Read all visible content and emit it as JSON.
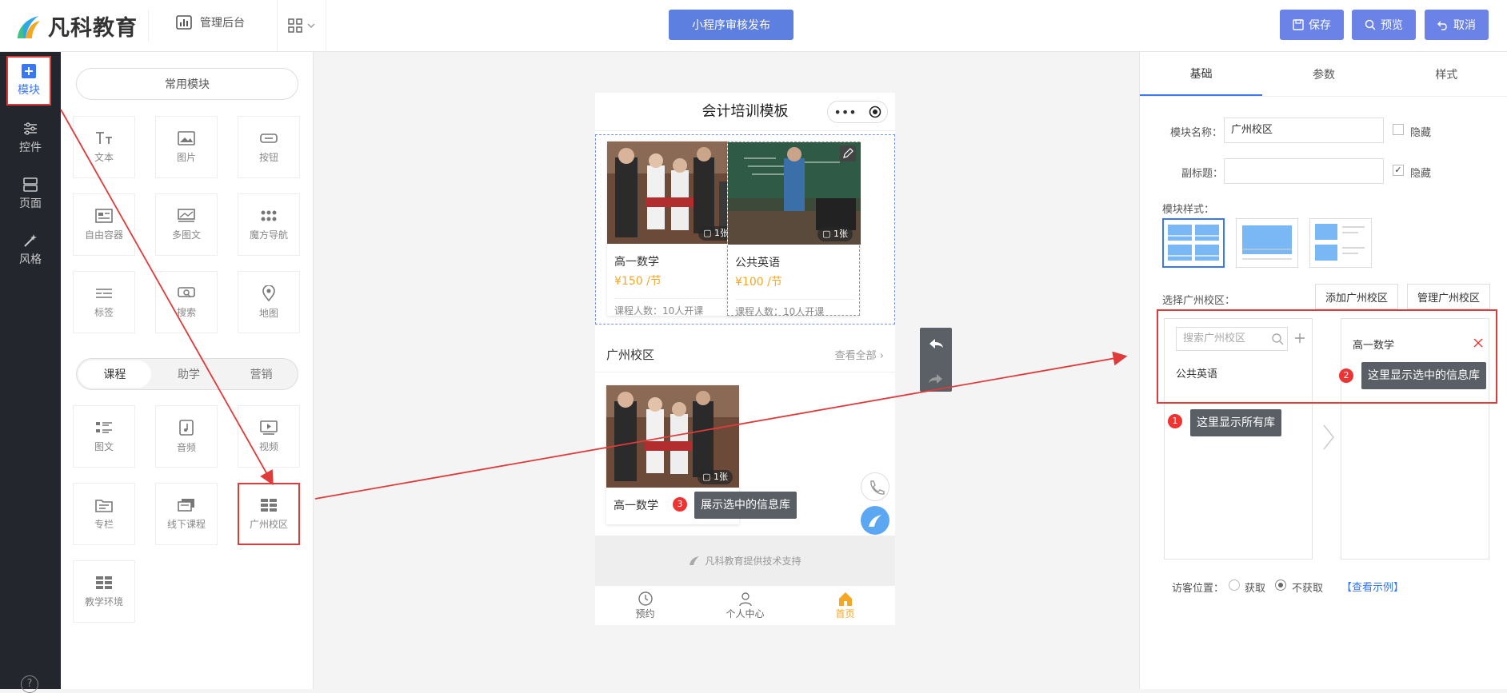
{
  "header": {
    "logo_text": "凡科教育",
    "admin_label": "管理后台",
    "publish_label": "小程序审核发布",
    "save_label": "保存",
    "preview_label": "预览",
    "cancel_label": "取消"
  },
  "rail": {
    "items": [
      {
        "label": "模块",
        "icon": "plus-square-icon"
      },
      {
        "label": "控件",
        "icon": "sliders-icon"
      },
      {
        "label": "页面",
        "icon": "pages-icon"
      },
      {
        "label": "风格",
        "icon": "magic-wand-icon"
      }
    ],
    "help": "?"
  },
  "panel": {
    "common_label": "常用模块",
    "common_tiles": [
      "文本",
      "图片",
      "按钮",
      "自由容器",
      "多图文",
      "魔方导航",
      "标签",
      "搜索",
      "地图"
    ],
    "tabs": [
      "课程",
      "助学",
      "营销"
    ],
    "course_tiles": [
      "图文",
      "音频",
      "视频",
      "专栏",
      "线下课程",
      "广州校区",
      "教学环境"
    ]
  },
  "phone": {
    "title": "会计培训模板",
    "cards_top": [
      {
        "name": "高一数学",
        "price": "¥150 /节",
        "enroll": "课程人数：10人开课",
        "count": "1张"
      },
      {
        "name": "公共英语",
        "price": "¥100 /节",
        "enroll": "课程人数：10人开课",
        "count": "1张"
      }
    ],
    "section_title": "广州校区",
    "view_all": "查看全部",
    "card_bottom": {
      "name": "高一数学",
      "count": "1张"
    },
    "footer": "凡科教育提供技术支持",
    "nav": [
      "预约",
      "个人中心",
      "首页"
    ]
  },
  "settings": {
    "tabs": [
      "基础",
      "参数",
      "样式"
    ],
    "module_name_label": "模块名称：",
    "module_name_value": "广州校区",
    "hide_label": "隐藏",
    "subtitle_label": "副标题：",
    "subtitle_value": "",
    "module_style_label": "模块样式：",
    "select_label": "选择广州校区：",
    "add_label": "添加广州校区",
    "manage_label": "管理广州校区",
    "search_placeholder": "搜索广州校区",
    "library_items": [
      "公共英语"
    ],
    "selected_items": [
      "高一数学"
    ],
    "visitor_label": "访客位置：",
    "get_label": "获取",
    "noget_label": "不获取",
    "example_label": "【查看示例】"
  },
  "annotations": {
    "tip1": "这里显示所有库",
    "tip2": "这里显示选中的信息库",
    "tip3": "展示选中的信息库",
    "n1": "1",
    "n2": "2",
    "n3": "3"
  },
  "colors": {
    "accent": "#6b83e6",
    "highlight": "#e03b3b",
    "price": "#f5a623"
  }
}
